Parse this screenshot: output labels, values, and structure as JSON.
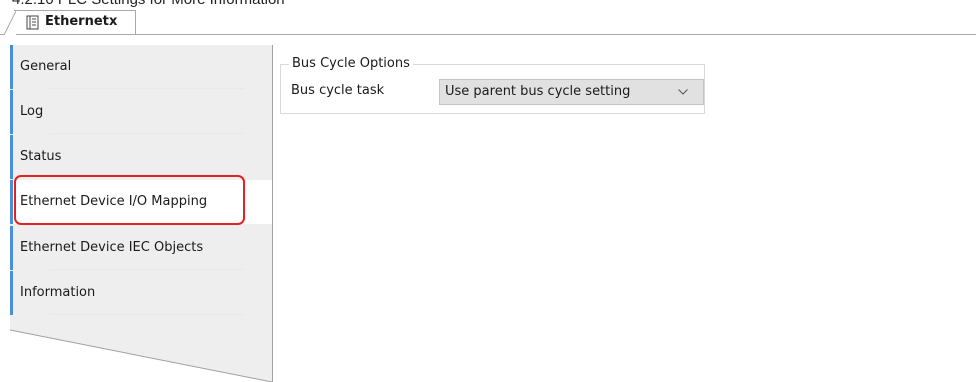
{
  "heading_fragment": "4.2.10 PLC Settings for More Information",
  "tab": {
    "label": "Ethernet",
    "close": "x"
  },
  "sidebar": {
    "items": [
      {
        "label": "General"
      },
      {
        "label": "Log"
      },
      {
        "label": "Status"
      },
      {
        "label": "Ethernet Device I/O Mapping"
      },
      {
        "label": "Ethernet Device IEC Objects"
      },
      {
        "label": "Information"
      }
    ],
    "active_index": 3
  },
  "bus_cycle": {
    "group_title": "Bus Cycle Options",
    "field_label": "Bus cycle task",
    "selected_value": "Use parent bus cycle setting"
  },
  "colors": {
    "accent_bar": "#4a90d9",
    "highlight": "#e32222",
    "nav_bg": "#eeeeee"
  }
}
